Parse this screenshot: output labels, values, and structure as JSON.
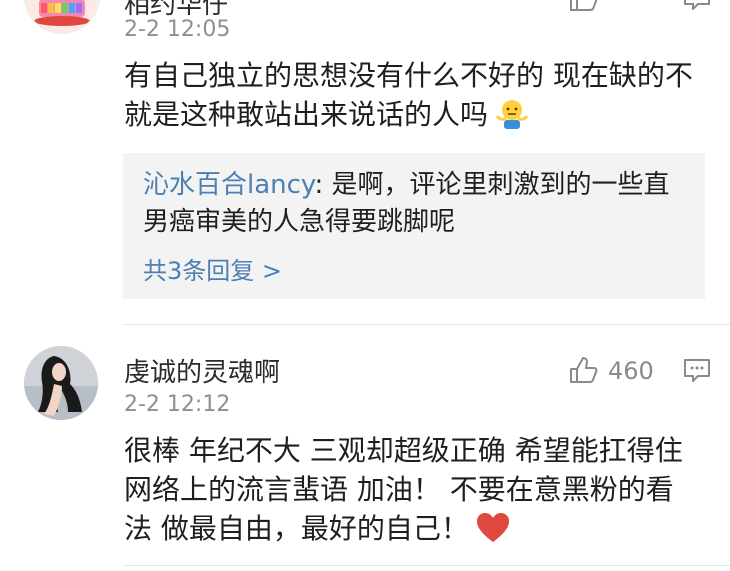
{
  "comments": [
    {
      "username": "相约华仔",
      "timestamp": "2-2 12:05",
      "text": "有自己独立的思想没有什么不好的 现在缺的不就是这种敢站出来说话的人吗",
      "emoji": "shrug-emoji",
      "reply": {
        "author": "沁水百合lancy",
        "separator": ": ",
        "text": "是啊，评论里刺激到的一些直男癌审美的人急得要跳脚呢",
        "more_label": "共3条回复 >"
      }
    },
    {
      "username": "虔诚的灵魂啊",
      "timestamp": "2-2 12:12",
      "like_count": "460",
      "text": "很棒  年纪不大 三观却超级正确 希望能扛得住网络上的流言蜚语 加油！ 不要在意黑粉的看法 做最自由，最好的自己！",
      "emoji": "red-heart-emoji"
    }
  ],
  "colors": {
    "link_blue": "#4d7fb3",
    "heart_red": "#e0473f",
    "reply_background": "#f3f3f3"
  }
}
